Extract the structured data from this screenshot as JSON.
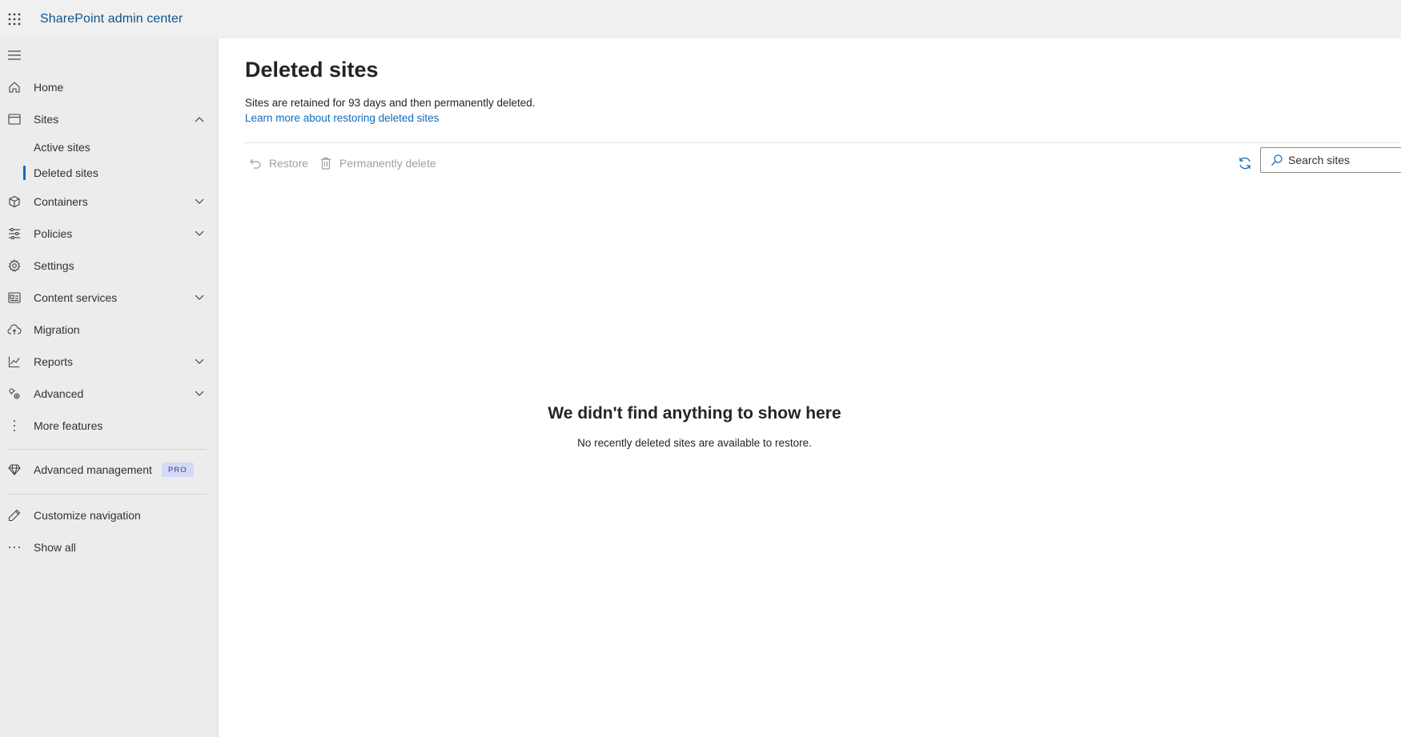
{
  "header": {
    "app_title": "SharePoint admin center",
    "waffle_icon": "app-launcher-icon"
  },
  "sidebar": {
    "collapse_icon": "hamburger-icon",
    "items": [
      {
        "label": "Home",
        "icon": "home-icon"
      },
      {
        "label": "Sites",
        "icon": "sites-icon",
        "expanded": true
      },
      {
        "label": "Containers",
        "icon": "cube-icon"
      },
      {
        "label": "Policies",
        "icon": "sliders-icon"
      },
      {
        "label": "Settings",
        "icon": "gear-icon"
      },
      {
        "label": "Content services",
        "icon": "content-services-icon"
      },
      {
        "label": "Migration",
        "icon": "cloud-upload-icon"
      },
      {
        "label": "Reports",
        "icon": "chart-line-icon"
      },
      {
        "label": "Advanced",
        "icon": "advanced-gears-icon"
      },
      {
        "label": "More features",
        "icon": "vertical-dots-icon"
      }
    ],
    "sites_children": [
      {
        "label": "Active sites"
      },
      {
        "label": "Deleted sites",
        "active": true
      }
    ],
    "advanced_management": {
      "label": "Advanced management",
      "badge": "PRO",
      "icon": "diamond-icon"
    },
    "customize": {
      "label": "Customize navigation",
      "icon": "pencil-icon"
    },
    "show_all": {
      "label": "Show all",
      "icon": "ellipsis-icon"
    }
  },
  "main": {
    "title": "Deleted sites",
    "description": "Sites are retained for 93 days and then permanently deleted.",
    "learn_link": "Learn more about restoring deleted sites",
    "toolbar": {
      "restore_label": "Restore",
      "permanent_delete_label": "Permanently delete"
    },
    "search": {
      "placeholder": "Search sites"
    },
    "empty": {
      "title": "We didn't find anything to show here",
      "subtitle": "No recently deleted sites are available to restore."
    }
  },
  "colors": {
    "brand": "#0f548c",
    "link": "#0f6cbd",
    "sidebar_bg": "#ececec",
    "topbar_bg": "#f0f0f0",
    "disabled_text": "#a19f9d"
  }
}
